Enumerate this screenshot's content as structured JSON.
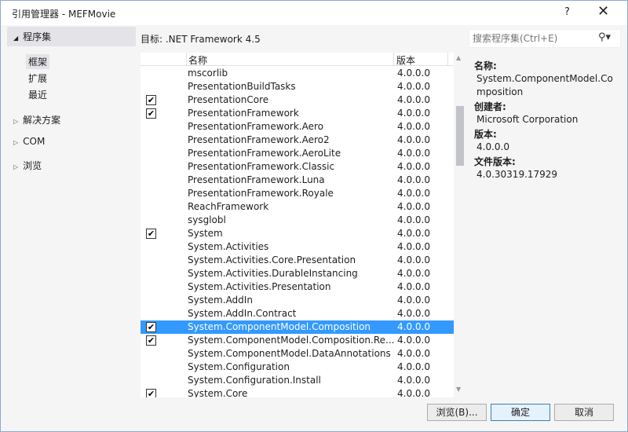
{
  "window": {
    "title": "引用管理器 - MEFMovie",
    "help": "?",
    "close": "✕"
  },
  "sidebar": {
    "header": "程序集",
    "sub_items": [
      "框架",
      "扩展",
      "最近"
    ],
    "selected_sub": 0,
    "categories": [
      "解决方案",
      "COM",
      "浏览"
    ]
  },
  "target": "目标: .NET Framework 4.5",
  "search": {
    "placeholder": "搜索程序集(Ctrl+E)",
    "icon": "search-icon"
  },
  "list": {
    "columns": [
      "名称",
      "版本"
    ],
    "selected_index": 19,
    "rows": [
      {
        "name": "mscorlib",
        "version": "4.0.0.0",
        "checked": false
      },
      {
        "name": "PresentationBuildTasks",
        "version": "4.0.0.0",
        "checked": false
      },
      {
        "name": "PresentationCore",
        "version": "4.0.0.0",
        "checked": true
      },
      {
        "name": "PresentationFramework",
        "version": "4.0.0.0",
        "checked": true
      },
      {
        "name": "PresentationFramework.Aero",
        "version": "4.0.0.0",
        "checked": false
      },
      {
        "name": "PresentationFramework.Aero2",
        "version": "4.0.0.0",
        "checked": false
      },
      {
        "name": "PresentationFramework.AeroLite",
        "version": "4.0.0.0",
        "checked": false
      },
      {
        "name": "PresentationFramework.Classic",
        "version": "4.0.0.0",
        "checked": false
      },
      {
        "name": "PresentationFramework.Luna",
        "version": "4.0.0.0",
        "checked": false
      },
      {
        "name": "PresentationFramework.Royale",
        "version": "4.0.0.0",
        "checked": false
      },
      {
        "name": "ReachFramework",
        "version": "4.0.0.0",
        "checked": false
      },
      {
        "name": "sysglobl",
        "version": "4.0.0.0",
        "checked": false
      },
      {
        "name": "System",
        "version": "4.0.0.0",
        "checked": true
      },
      {
        "name": "System.Activities",
        "version": "4.0.0.0",
        "checked": false
      },
      {
        "name": "System.Activities.Core.Presentation",
        "version": "4.0.0.0",
        "checked": false
      },
      {
        "name": "System.Activities.DurableInstancing",
        "version": "4.0.0.0",
        "checked": false
      },
      {
        "name": "System.Activities.Presentation",
        "version": "4.0.0.0",
        "checked": false
      },
      {
        "name": "System.AddIn",
        "version": "4.0.0.0",
        "checked": false
      },
      {
        "name": "System.AddIn.Contract",
        "version": "4.0.0.0",
        "checked": false
      },
      {
        "name": "System.ComponentModel.Composition",
        "version": "4.0.0.0",
        "checked": true
      },
      {
        "name": "System.ComponentModel.Composition.Re...",
        "version": "4.0.0.0",
        "checked": true
      },
      {
        "name": "System.ComponentModel.DataAnnotations",
        "version": "4.0.0.0",
        "checked": false
      },
      {
        "name": "System.Configuration",
        "version": "4.0.0.0",
        "checked": false
      },
      {
        "name": "System.Configuration.Install",
        "version": "4.0.0.0",
        "checked": false
      },
      {
        "name": "System.Core",
        "version": "4.0.0.0",
        "checked": true
      }
    ]
  },
  "details": {
    "name_label": "名称:",
    "name": "System.ComponentModel.Composition",
    "creator_label": "创建者:",
    "creator": "Microsoft Corporation",
    "version_label": "版本:",
    "version": "4.0.0.0",
    "file_version_label": "文件版本:",
    "file_version": "4.0.30319.17929"
  },
  "buttons": {
    "browse": "浏览(B)...",
    "ok": "确定",
    "cancel": "取消"
  },
  "colors": {
    "selection": "#3399ff",
    "border": "#8aa9cf"
  }
}
